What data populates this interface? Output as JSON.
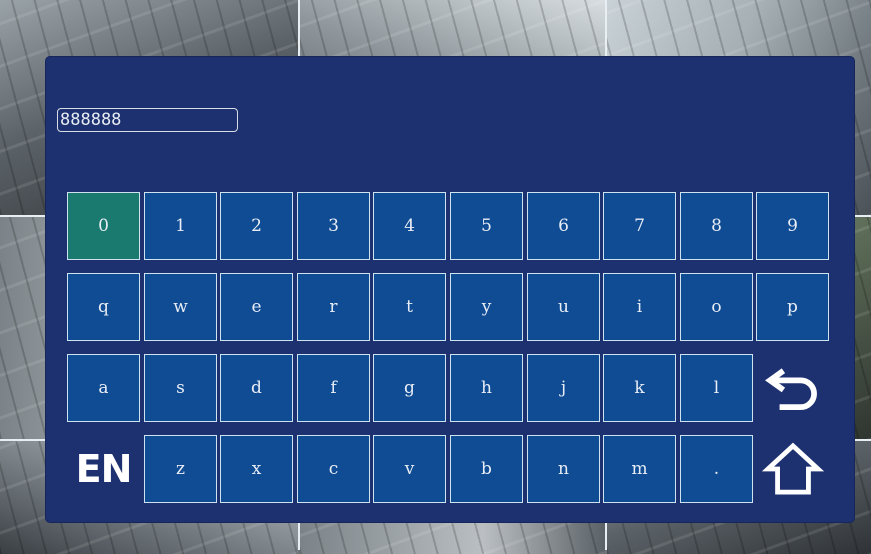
{
  "password_field": {
    "value": "888888"
  },
  "keyboard": {
    "rows": [
      [
        "0",
        "1",
        "2",
        "3",
        "4",
        "5",
        "6",
        "7",
        "8",
        "9"
      ],
      [
        "q",
        "w",
        "e",
        "r",
        "t",
        "y",
        "u",
        "i",
        "o",
        "p"
      ],
      [
        "a",
        "s",
        "d",
        "f",
        "g",
        "h",
        "j",
        "k",
        "l"
      ],
      [
        "z",
        "x",
        "c",
        "v",
        "b",
        "n",
        "m",
        "."
      ]
    ],
    "selected_key": "0",
    "language_label": "EN",
    "backspace_icon": "return-arrow-icon",
    "home_icon": "home-icon"
  },
  "colors": {
    "panel": "#1d3170",
    "key": "#0f4c94",
    "key_selected": "#1b7a6f",
    "key_border": "#cfe3ef",
    "text": "#e9edf5"
  }
}
